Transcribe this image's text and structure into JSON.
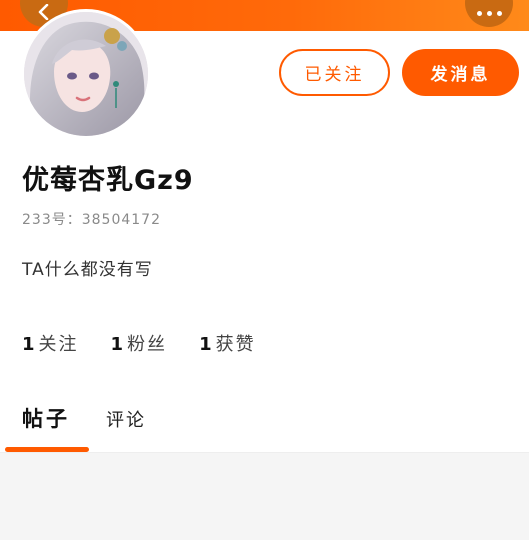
{
  "header": {
    "back_icon": "chevron-left-icon",
    "more_icon": "more-dots-icon",
    "gradient_start": "#ff5a00",
    "gradient_end": "#ff8a1a"
  },
  "profile": {
    "avatar": "avatar-illustration-silver-hair",
    "nickname": "优莓杏乳Gz9",
    "uid_text": "233号：38504172",
    "bio": "TA什么都没有写"
  },
  "actions": {
    "follow_label": "已关注",
    "message_label": "发消息",
    "accent_color": "#ff5a00"
  },
  "stats": [
    {
      "value": "1",
      "label": "关注"
    },
    {
      "value": "1",
      "label": "粉丝"
    },
    {
      "value": "1",
      "label": "获赞"
    }
  ],
  "tabs": {
    "posts": "帖子",
    "comments": "评论",
    "active": "帖子"
  }
}
